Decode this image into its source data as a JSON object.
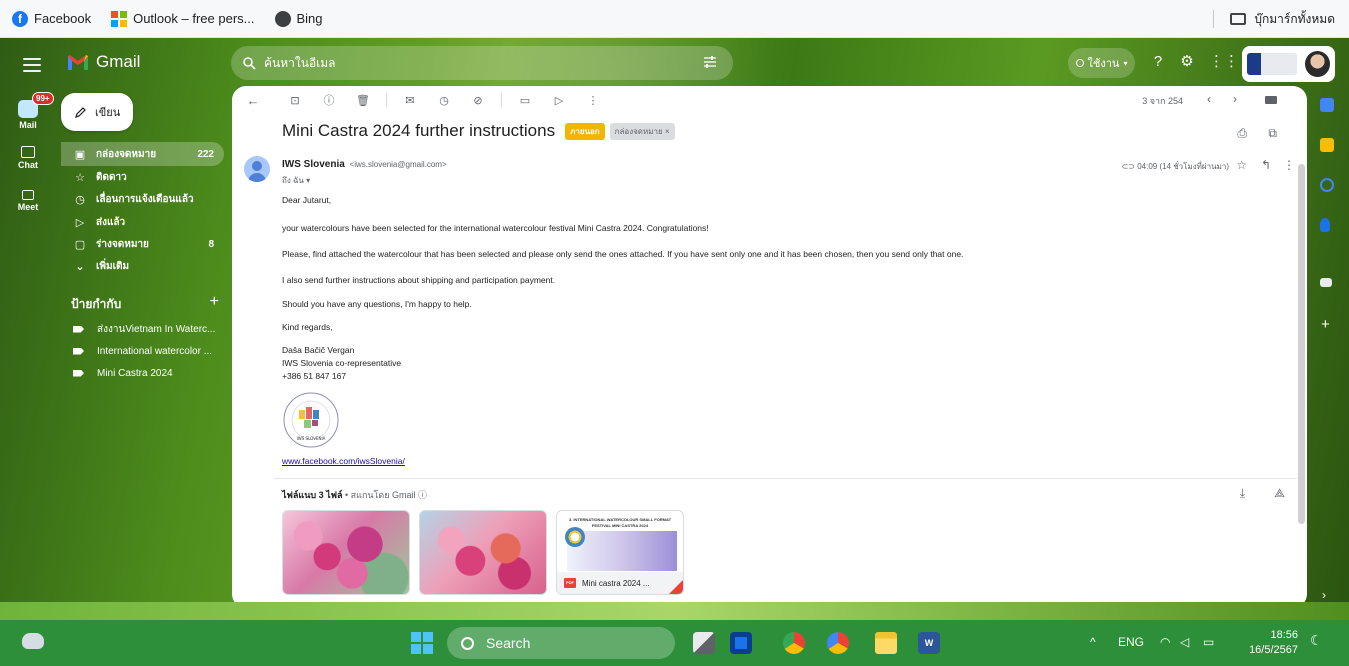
{
  "bookmarks": {
    "items": [
      {
        "label": "Facebook"
      },
      {
        "label": "Outlook – free pers..."
      },
      {
        "label": "Bing"
      }
    ],
    "all_bookmarks": "บุ๊กมาร์กทั้งหมด"
  },
  "gmail": {
    "app_name": "Gmail",
    "search_placeholder": "ค้นหาในอีเมล",
    "status": "ใช้งาน",
    "compose_label": "เขียน",
    "rail": [
      {
        "label": "Mail",
        "badge": "99+"
      },
      {
        "label": "Chat"
      },
      {
        "label": "Meet"
      }
    ],
    "nav": [
      {
        "label": "กล่องจดหมาย",
        "count": "222"
      },
      {
        "label": "ติดดาว",
        "count": ""
      },
      {
        "label": "เลื่อนการแจ้งเตือนแล้ว",
        "count": ""
      },
      {
        "label": "ส่งแล้ว",
        "count": ""
      },
      {
        "label": "ร่างจดหมาย",
        "count": "8"
      },
      {
        "label": "เพิ่มเติม",
        "count": ""
      }
    ],
    "labels_title": "ป้ายกำกับ",
    "labels": [
      {
        "label": "ส่งงานVietnam In Waterc..."
      },
      {
        "label": "International watercolor ..."
      },
      {
        "label": "Mini Castra 2024"
      }
    ]
  },
  "email": {
    "pager": "3 จาก 254",
    "subject": "Mini Castra 2024 further instructions",
    "chip_external": "ภายนอก",
    "chip_inbox": "กล่องจดหมาย ×",
    "sender_name": "IWS Slovenia",
    "sender_email": "<iws.slovenia@gmail.com>",
    "to": "ถึง ฉัน ▾",
    "time": "04:09 (14 ชั่วโมงที่ผ่านมา)",
    "body": [
      "Dear Jutarut,",
      "your watercolours have been selected for the international watercolour festival Mini Castra 2024. Congratulations!",
      "Please, find attached the watercolour that has been selected and please only send the ones attached. If you have sent only one and it has been chosen, then you send only that one.",
      "I also send further instructions about shipping and participation payment.",
      "Should you have any questions, I'm happy to help.",
      "Kind regards,"
    ],
    "signature": [
      "Daša Bačič Vergan",
      "IWS Slovenia co-representative",
      "+386 51 847 167"
    ],
    "logo_text": "IWS SLOVENIA",
    "link": "www.facebook.com/iwsSlovenia/",
    "attachments_title": "ไฟล์แนบ 3 ไฟล์",
    "attachments_scan": " • สแกนโดย Gmail ⓘ",
    "pdf_header": "3. INTERNATIONAL WATERCOLOUR SMALL FORMAT FESTIVAL MINI CASTRA 2024",
    "pdf_name": "Mini castra 2024 ...",
    "pdf_badge": "PDF"
  },
  "taskbar": {
    "search_label": "Search",
    "lang": "ENG",
    "time": "18:56",
    "date": "16/5/2567"
  },
  "colors": {
    "accent_chip": "#f4b400",
    "taskbar": "#2d8f3a",
    "link": "#1a0dab"
  }
}
